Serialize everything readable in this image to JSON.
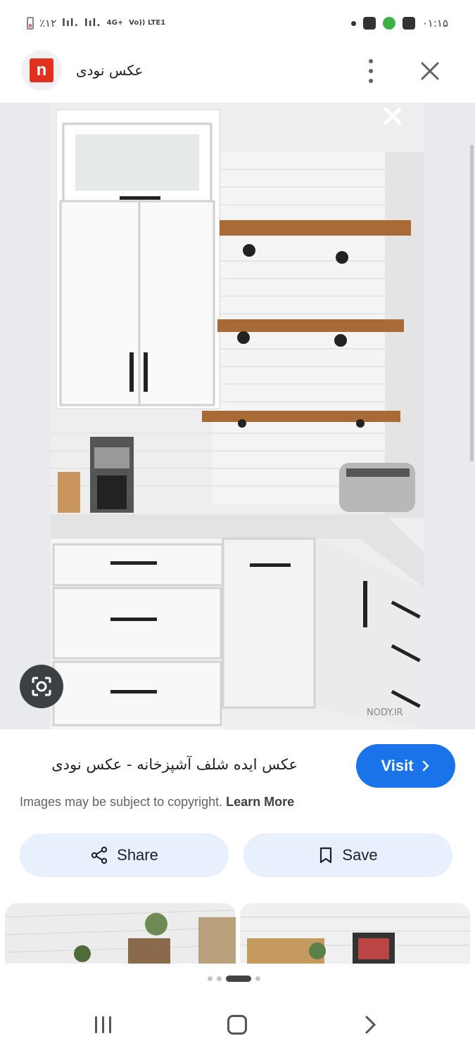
{
  "status_bar": {
    "left_text": "٪۱۲",
    "signal1": "lıl.",
    "signal2": "lıl.",
    "network_top": "4G+",
    "network_bottom": "Vo)) LTE1",
    "time": "۰۱:۱۵"
  },
  "header": {
    "logo_letter": "n",
    "site_name": "عکس نودی"
  },
  "image": {
    "watermark": "NODY.IR"
  },
  "result": {
    "title": "عکس ایده شلف آشپزخانه - عکس نودی",
    "visit_label": "Visit",
    "copyright_text": "Images may be subject to copyright.",
    "learn_more": "Learn More"
  },
  "actions": {
    "share_label": "Share",
    "save_label": "Save"
  },
  "colors": {
    "visit_blue": "#1a73e8",
    "action_bg": "#e8f0fe",
    "logo_red": "#e0301e"
  },
  "icons": {
    "more": "more-vert-icon",
    "close": "close-icon",
    "lens": "lens-icon",
    "share": "share-icon",
    "bookmark": "bookmark-icon",
    "chevron": "chevron-right-icon"
  }
}
